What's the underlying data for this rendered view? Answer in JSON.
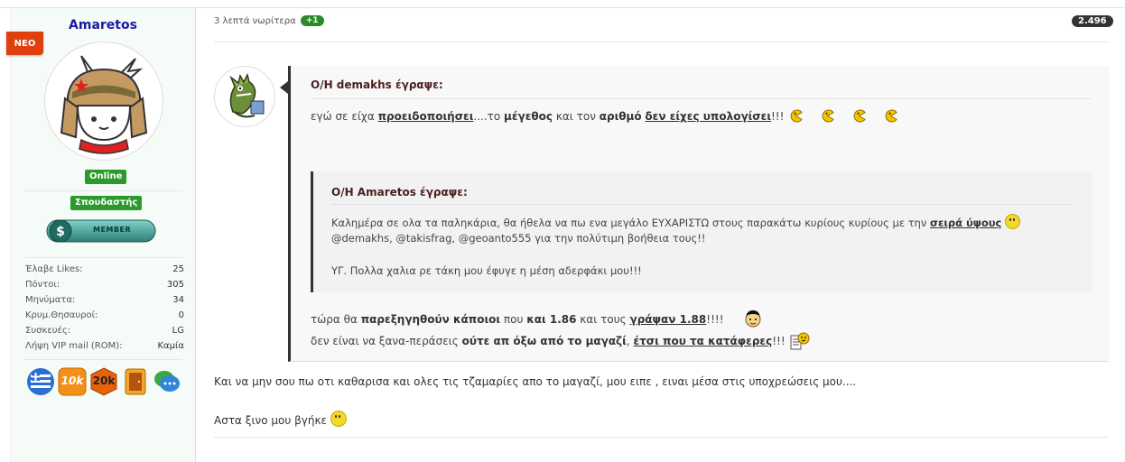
{
  "user": {
    "name": "Amaretos",
    "new_badge": "NEO",
    "status": "Online",
    "rank": "Σπουδαστής",
    "member_badge": "MEMBER",
    "stats": [
      {
        "label": "Έλαβε Likes:",
        "value": "25"
      },
      {
        "label": "Πόντοι:",
        "value": "305"
      },
      {
        "label": "Μηνύματα:",
        "value": "34"
      },
      {
        "label": "Κρυμ.Θησαυροί:",
        "value": "0"
      },
      {
        "label": "Συσκευές:",
        "value": "LG"
      },
      {
        "label": "Λήψη VIP mail (ROM):",
        "value": "Καμία"
      }
    ],
    "award_icons": [
      "greek-flag-icon",
      "10k-icon",
      "20k-icon",
      "door-icon",
      "chat-bubbles-icon"
    ],
    "award_texts": {
      "ten_k": "10k",
      "twenty_k": "20k"
    }
  },
  "post": {
    "time": "3 λεπτά νωρίτερα",
    "likes_delta": "+1",
    "post_number": "2.496"
  },
  "quote": {
    "author_line": "Ο/Η demakhs έγραψε:",
    "line1": {
      "t1": "εγώ σε είχα ",
      "u1": "προειδοποιήσει",
      "t2": "....το ",
      "b1": "μέγεθος",
      "t3": " και τον ",
      "b2": "αριθμό",
      "t4": " ",
      "u2": "δεν είχες υπολογίσει",
      "t5": "!!!"
    },
    "nested": {
      "author_line": "Ο/Η Amaretos έγραψε:",
      "line1": {
        "t1": "Καλημέρα σε ολα τα παληκάρια, θα ήθελα να πω ενα μεγάλο ΕΥΧΑΡΙΣΤΩ στους παρακάτω κυρίους κυρίους με την ",
        "u1": "σειρά ύψους"
      },
      "line2": "@demakhs, @takisfrag, @geoanto555 για την πολύτιμη βοήθεια τους!!",
      "line3": "ΥΓ. Πολλα χαλια ρε τάκη μου έφυγε η μέση αδερφάκι μου!!!"
    },
    "line2": {
      "t1": "τώρα θα ",
      "b1": "παρεξηγηθούν κάποιοι",
      "t2": " που ",
      "b2": "και 1.86",
      "t3": " και τους ",
      "u1": "γράψαν 1.88",
      "t4": "!!!!"
    },
    "line3": {
      "t1": "δεν είναι να ξανα-περάσεις ",
      "b1": "ούτε απ όξω από το μαγαζί",
      "t2": ", ",
      "u1": "έτσι που τα κατάφερες",
      "t3": "!!!"
    }
  },
  "body": {
    "line1": "Και να μην σου πω οτι καθαρισα και ολες τις τζαμαρίες απο το μαγαζί, μου ειπε , ειναι μέσα στις υποχρεώσεις μου....",
    "line2": "Αστα ξινο μου βγήκε"
  },
  "colors": {
    "accent_green": "#2a9a2a",
    "new_badge": "#e0400e",
    "username": "#1a1aa8"
  }
}
